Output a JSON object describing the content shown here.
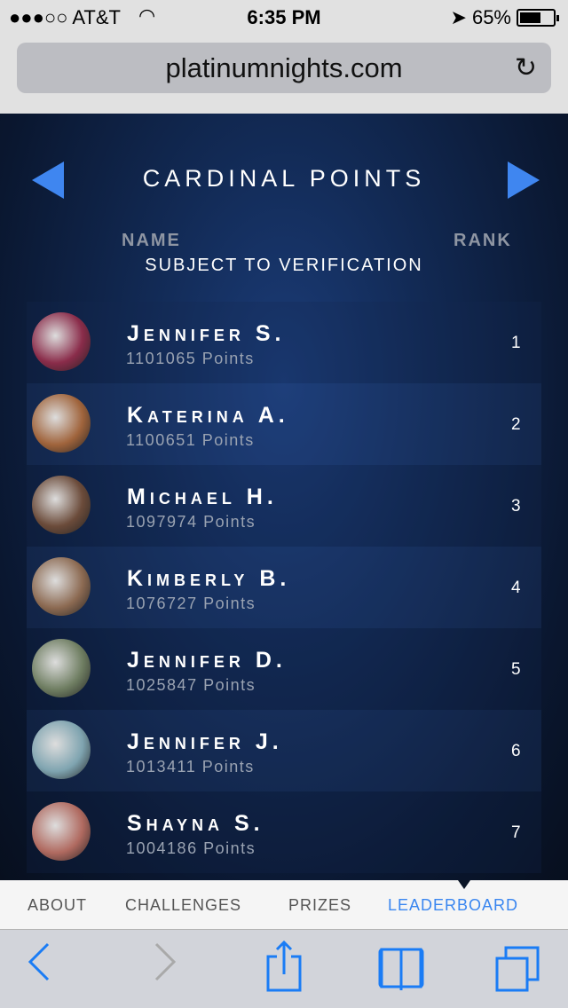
{
  "status": {
    "carrier": "●●●○○ AT&T",
    "time": "6:35 PM",
    "battery": "65%",
    "battery_level": 0.65
  },
  "browser": {
    "url": "platinumnights.com"
  },
  "board": {
    "title": "CARDINAL POINTS",
    "col_name": "NAME",
    "col_rank": "RANK",
    "note": "SUBJECT TO VERIFICATION",
    "rows": [
      {
        "name": "Jennifer S.",
        "points": "1101065 Points",
        "rank": "1",
        "color": "#8a2c4a"
      },
      {
        "name": "Katerina A.",
        "points": "1100651 Points",
        "rank": "2",
        "color": "#a0643c"
      },
      {
        "name": "Michael H.",
        "points": "1097974 Points",
        "rank": "3",
        "color": "#6b4b3a"
      },
      {
        "name": "Kimberly B.",
        "points": "1076727 Points",
        "rank": "4",
        "color": "#8c6a52"
      },
      {
        "name": "Jennifer D.",
        "points": "1025847 Points",
        "rank": "5",
        "color": "#6f7e62"
      },
      {
        "name": "Jennifer J.",
        "points": "1013411 Points",
        "rank": "6",
        "color": "#7fa4b0"
      },
      {
        "name": "Shayna S.",
        "points": "1004186 Points",
        "rank": "7",
        "color": "#b06a60"
      }
    ]
  },
  "nav": {
    "about": "ABOUT",
    "challenges": "CHALLENGES",
    "prizes": "PRIZES",
    "leaderboard": "LEADERBOARD"
  },
  "colors": {
    "accent": "#3a86f0"
  }
}
